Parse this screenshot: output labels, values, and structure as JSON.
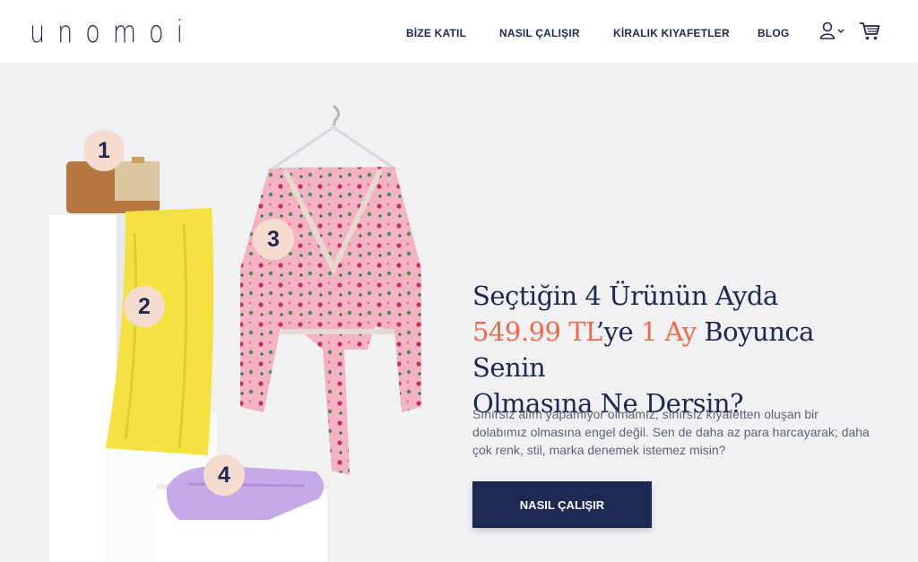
{
  "brand": {
    "logo": "unomoi"
  },
  "nav": {
    "items": [
      {
        "label": "BİZE KATIL"
      },
      {
        "label": "NASIL ÇALIŞIR"
      },
      {
        "label": "KİRALIK KIYAFETLER"
      },
      {
        "label": "BLOG"
      }
    ],
    "icons": {
      "user": "user-icon",
      "cart": "cart-icon"
    }
  },
  "hero": {
    "badges": [
      "1",
      "2",
      "3",
      "4"
    ],
    "headline": {
      "line1": "Seçtiğin 4 Ürünün Ayda",
      "price": "549.99 TL",
      "mid": "’ye ",
      "duration": "1 Ay",
      "rest": " Boyunca Senin",
      "line3": "Olmasına Ne Dersin?"
    },
    "description": "Sınırsız alım yapamıyor olmamız, sınırsız kıyafetten oluşan bir dolabımız olmasına engel değil. Sen de daha az para harcayarak; daha çok renk, stil, marka denemek istemez misin?",
    "cta": "NASIL ÇALIŞIR"
  },
  "colors": {
    "navy": "#1d2951",
    "accent": "#ef6a4c",
    "background": "#f1f0f3",
    "badge": "#f6dccf"
  }
}
